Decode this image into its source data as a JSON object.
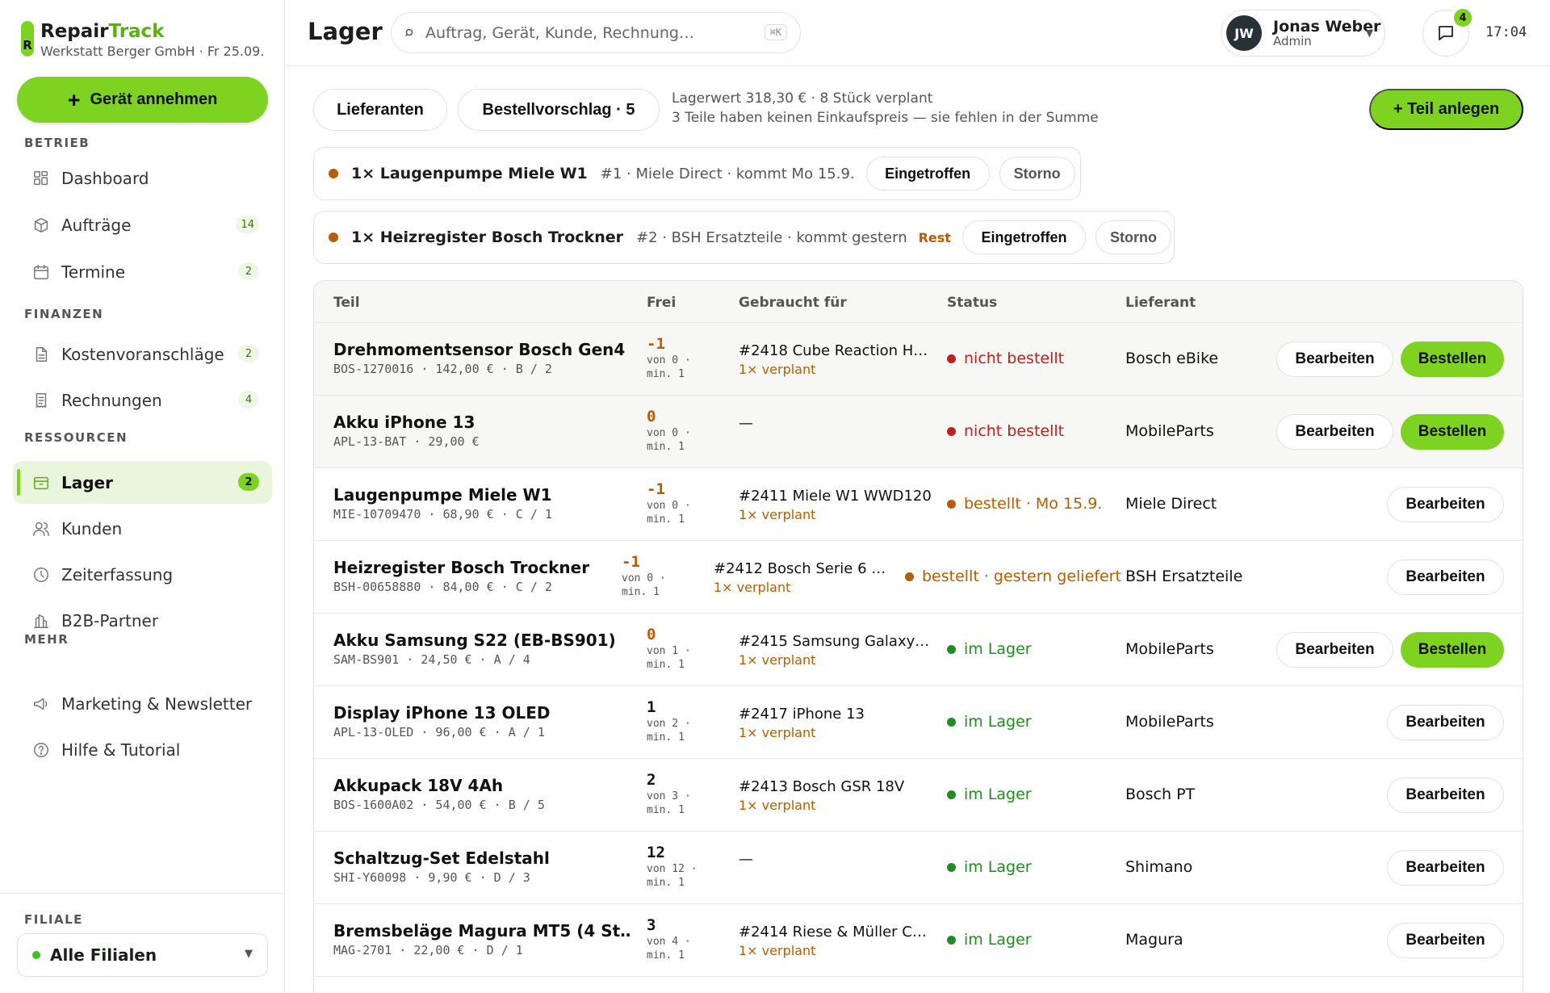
{
  "brand": {
    "name_main": "Repair",
    "name_accent": "Track",
    "logo_letter": "R",
    "subtitle": "Werkstatt Berger GmbH · Fr 25.09."
  },
  "sidebar": {
    "primary_action": "Gerät annehmen",
    "sections": [
      {
        "label": "BETRIEB",
        "items": [
          {
            "label": "Dashboard",
            "icon": "grid-icon",
            "count": ""
          },
          {
            "label": "Aufträge",
            "icon": "box-icon",
            "count": "14"
          },
          {
            "label": "Termine",
            "icon": "calendar-icon",
            "count": "2"
          }
        ]
      },
      {
        "label": "FINANZEN",
        "items": [
          {
            "label": "Kostenvoranschläge",
            "icon": "document-icon",
            "count": "2"
          },
          {
            "label": "Rechnungen",
            "icon": "receipt-icon",
            "count": "4"
          }
        ]
      },
      {
        "label": "RESSOURCEN",
        "items": [
          {
            "label": "Lager",
            "icon": "inventory-icon",
            "count": "2",
            "active": true
          },
          {
            "label": "Kunden",
            "icon": "users-icon",
            "count": ""
          },
          {
            "label": "Zeiterfassung",
            "icon": "clock-icon",
            "count": ""
          },
          {
            "label": "B2B-Partner",
            "icon": "building-icon",
            "count": ""
          }
        ]
      },
      {
        "label": "MEHR",
        "items": [
          {
            "label": "Marketing & Newsletter",
            "icon": "megaphone-icon",
            "count": ""
          },
          {
            "label": "Hilfe & Tutorial",
            "icon": "help-icon",
            "count": ""
          }
        ]
      }
    ],
    "filiale": {
      "label": "FILIALE",
      "value": "Alle Filialen"
    }
  },
  "header": {
    "title": "Lager",
    "search_placeholder": "Auftrag, Gerät, Kunde, Rechnung…",
    "search_shortcut": "⌘K",
    "user": {
      "initials": "JW",
      "name": "Jonas Weber",
      "role": "Admin"
    },
    "messages_count": "4",
    "time": "17:04"
  },
  "toolbar": {
    "suppliers_label": "Lieferanten",
    "suggestion_label": "Bestellvorschlag · 5",
    "stock_value": "Lagerwert 318,30 € · 8 Stück verplant",
    "stock_warning": "3 Teile haben keinen Einkaufspreis — sie fehlen in der Summe",
    "new_part_label": "+ Teil anlegen"
  },
  "open_orders": [
    {
      "title": "1× Laugenpumpe Miele W1",
      "meta": "#1 · Miele Direct · kommt Mo 15.9.",
      "rest": "",
      "arrived_label": "Eingetroffen",
      "cancel_label": "Storno"
    },
    {
      "title": "1× Heizregister Bosch Trockner",
      "meta": "#2 · BSH Ersatzteile · kommt gestern",
      "rest": "Rest",
      "arrived_label": "Eingetroffen",
      "cancel_label": "Storno"
    }
  ],
  "table": {
    "columns": {
      "part": "Teil",
      "free": "Frei",
      "used_for": "Gebraucht für",
      "status": "Status",
      "supplier": "Lieferant"
    },
    "edit_label": "Bearbeiten",
    "order_label": "Bestellen",
    "rows": [
      {
        "name": "Drehmomentsensor Bosch Gen4",
        "meta": "BOS-1270016 · 142,00 € · B / 2",
        "free": "-1",
        "free_sub": "von 0 · min. 1",
        "used": "#2418 Cube Reaction H…",
        "used_sub": "1× verplant",
        "status": "nicht bestellt",
        "status_color": "red",
        "supplier": "Bosch eBike",
        "can_order": true
      },
      {
        "name": "Akku iPhone 13",
        "meta": "APL-13-BAT · 29,00 €",
        "free": "0",
        "free_sub": "von 0 · min. 1",
        "used": "—",
        "used_sub": "",
        "status": "nicht bestellt",
        "status_color": "red",
        "supplier": "MobileParts",
        "can_order": true
      },
      {
        "name": "Laugenpumpe Miele W1",
        "meta": "MIE-10709470 · 68,90 € · C / 1",
        "free": "-1",
        "free_sub": "von 0 · min. 1",
        "used": "#2411 Miele W1 WWD120",
        "used_sub": "1× verplant",
        "status": "bestellt · Mo 15.9.",
        "status_color": "orange",
        "supplier": "Miele Direct",
        "can_order": false
      },
      {
        "name": "Heizregister Bosch Trockner",
        "meta": "BSH-00658880 · 84,00 € · C / 2",
        "free": "-1",
        "free_sub": "von 0 · min. 1",
        "used": "#2412 Bosch Serie 6 …",
        "used_sub": "1× verplant",
        "status": "bestellt · gestern geliefert",
        "status_color": "orange",
        "supplier": "BSH Ersatzteile",
        "can_order": false
      },
      {
        "name": "Akku Samsung S22 (EB-BS901)",
        "meta": "SAM-BS901 · 24,50 € · A / 4",
        "free": "0",
        "free_sub": "von 1 · min. 1",
        "used": "#2415 Samsung Galaxy…",
        "used_sub": "1× verplant",
        "status": "im Lager",
        "status_color": "green",
        "supplier": "MobileParts",
        "can_order": true
      },
      {
        "name": "Display iPhone 13 OLED",
        "meta": "APL-13-OLED · 96,00 € · A / 1",
        "free": "1",
        "free_sub": "von 2 · min. 1",
        "used": "#2417 iPhone 13",
        "used_sub": "1× verplant",
        "status": "im Lager",
        "status_color": "green",
        "supplier": "MobileParts",
        "can_order": false
      },
      {
        "name": "Akkupack 18V 4Ah",
        "meta": "BOS-1600A02 · 54,00 € · B / 5",
        "free": "2",
        "free_sub": "von 3 · min. 1",
        "used": "#2413 Bosch GSR 18V",
        "used_sub": "1× verplant",
        "status": "im Lager",
        "status_color": "green",
        "supplier": "Bosch PT",
        "can_order": false
      },
      {
        "name": "Schaltzug-Set Edelstahl",
        "meta": "SHI-Y60098 · 9,90 € · D / 3",
        "free": "12",
        "free_sub": "von 12 · min. 1",
        "used": "—",
        "used_sub": "",
        "status": "im Lager",
        "status_color": "green",
        "supplier": "Shimano",
        "can_order": false
      },
      {
        "name": "Bremsbeläge Magura MT5 (4 St…",
        "meta": "MAG-2701 · 22,00 € · D / 1",
        "free": "3",
        "free_sub": "von 4 · min. 1",
        "used": "#2414 Riese & Müller C…",
        "used_sub": "1× verplant",
        "status": "im Lager",
        "status_color": "green",
        "supplier": "Magura",
        "can_order": false
      }
    ]
  }
}
